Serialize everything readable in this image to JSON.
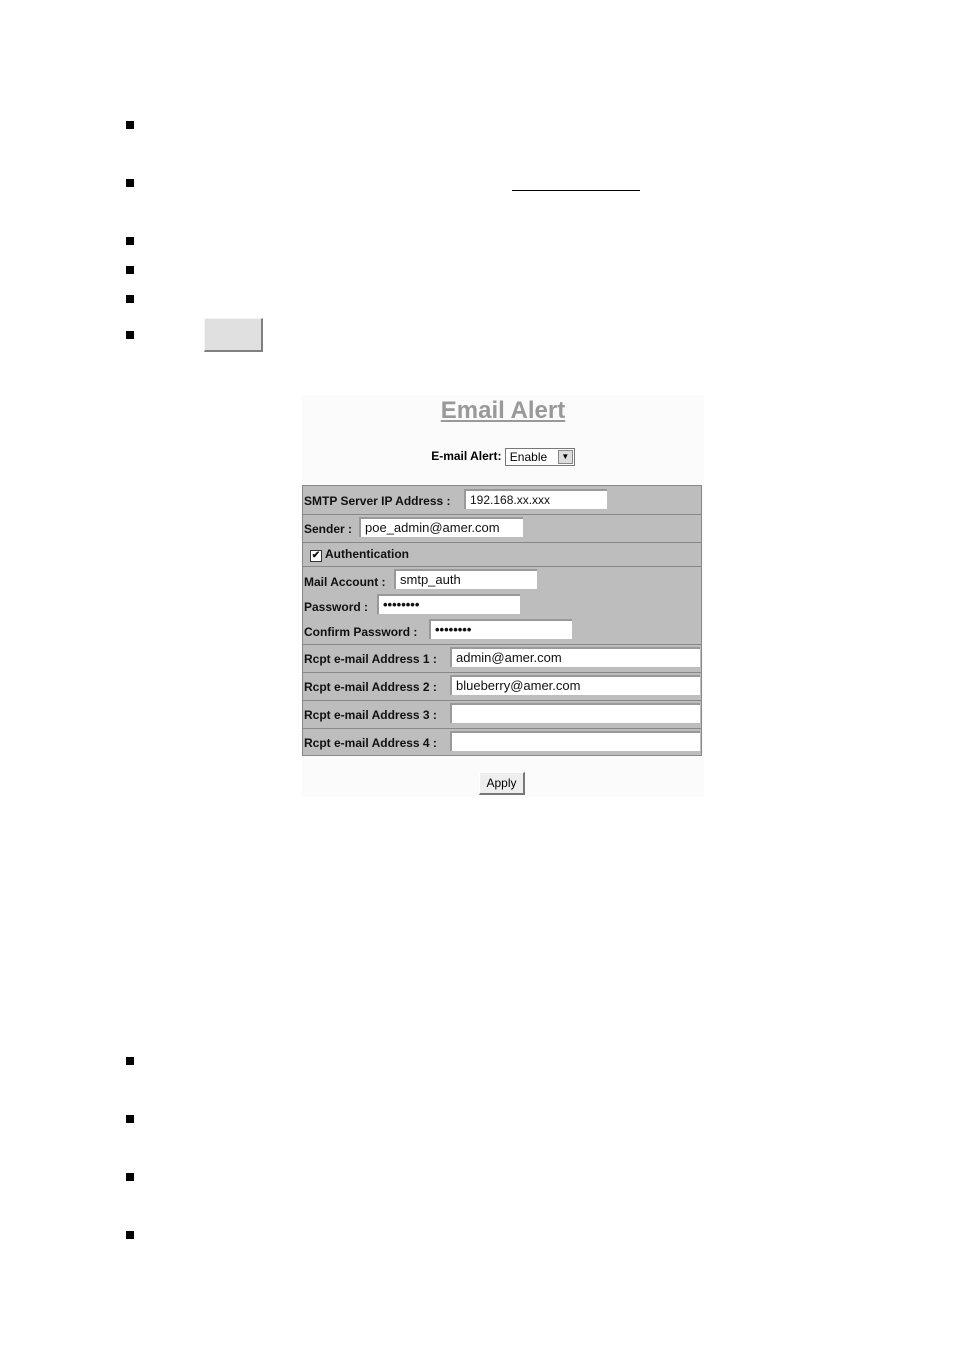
{
  "email_alert_page": {
    "title": "Email Alert",
    "alert_label": "E-mail Alert:",
    "alert_value": "Enable",
    "smtp_label": "SMTP Server IP Address :",
    "smtp_value": "192.168.xx.xxx",
    "sender_label": "Sender :",
    "sender_value": "poe_admin@amer.com",
    "auth_label": "Authentication",
    "auth_checked": true,
    "account_label": "Mail Account :",
    "account_value": "smtp_auth",
    "password_label": "Password :",
    "password_value": "••••••••",
    "confirm_label": "Confirm Password :",
    "confirm_value": "••••••••",
    "rcpt": [
      {
        "label": "Rcpt e-mail Address 1 :",
        "value": "admin@amer.com"
      },
      {
        "label": "Rcpt e-mail Address 2 :",
        "value": "blueberry@amer.com"
      },
      {
        "label": "Rcpt e-mail Address 3 :",
        "value": ""
      },
      {
        "label": "Rcpt e-mail Address 4 :",
        "value": ""
      }
    ],
    "apply_label": "Apply"
  },
  "icons": {
    "bullet": "square-bullet",
    "checkbox": "checkmark",
    "dropdown": "triangle-down"
  }
}
